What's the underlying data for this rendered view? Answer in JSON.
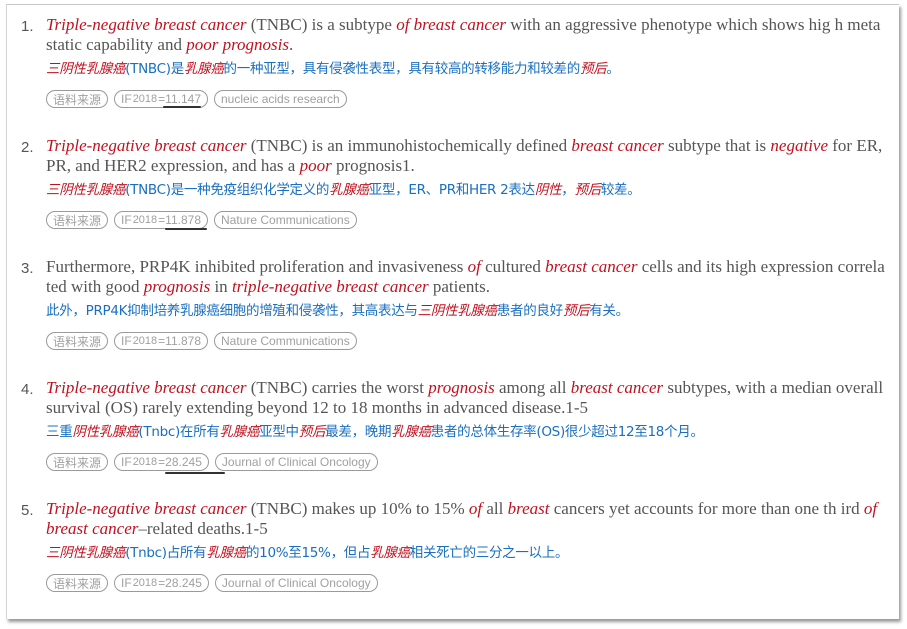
{
  "items": [
    {
      "number": "1.",
      "en_parts": [
        {
          "t": "Triple-negative breast cancer",
          "hl": true
        },
        {
          "t": " (TNBC) is a subtype ",
          "hl": false
        },
        {
          "t": "of breast cancer",
          "hl": true
        },
        {
          "t": " with an aggressive phenotype which shows hig h metastatic capability and ",
          "hl": false
        },
        {
          "t": "poor prognosis",
          "hl": true
        },
        {
          "t": ".",
          "hl": false
        }
      ],
      "zh_parts": [
        {
          "t": "三阴性乳腺癌",
          "hl": true
        },
        {
          "t": "(TNBC)是",
          "hl": false
        },
        {
          "t": "乳腺癌",
          "hl": true
        },
        {
          "t": "的一种亚型，具有侵袭性表型，具有较高的转移能力和较差的",
          "hl": false
        },
        {
          "t": "预后",
          "hl": true
        },
        {
          "t": "。",
          "hl": false
        }
      ],
      "tags": {
        "source": "语料来源",
        "if_prefix": "IF",
        "if_year": "2018",
        "if_value": "=11.147",
        "journal": "nucleic acids research"
      },
      "if_underlined": true
    },
    {
      "number": "2.",
      "en_parts": [
        {
          "t": "Triple-negative breast cancer",
          "hl": true
        },
        {
          "t": " (TNBC) is an immunohistochemically defined ",
          "hl": false
        },
        {
          "t": "breast cancer",
          "hl": true
        },
        {
          "t": " subtype that is ",
          "hl": false
        },
        {
          "t": "negative",
          "hl": true
        },
        {
          "t": " for ER, PR, and HER2 expression, and has a ",
          "hl": false
        },
        {
          "t": "poor",
          "hl": true
        },
        {
          "t": " prognosis1.",
          "hl": false
        }
      ],
      "zh_parts": [
        {
          "t": "三阴性乳腺癌",
          "hl": true
        },
        {
          "t": "(TNBC)是一种免疫组织化学定义的",
          "hl": false
        },
        {
          "t": "乳腺癌",
          "hl": true
        },
        {
          "t": "亚型，ER、PR和HER 2表达",
          "hl": false
        },
        {
          "t": "阴性",
          "hl": true
        },
        {
          "t": "，",
          "hl": false
        },
        {
          "t": "预后",
          "hl": true
        },
        {
          "t": "较差。",
          "hl": false
        }
      ],
      "tags": {
        "source": "语料来源",
        "if_prefix": "IF",
        "if_year": "2018",
        "if_value": "=11.878",
        "journal": "Nature Communications"
      },
      "if_underlined": true
    },
    {
      "number": "3.",
      "en_parts": [
        {
          "t": "Furthermore, PRP4K inhibited proliferation and invasiveness ",
          "hl": false
        },
        {
          "t": "of",
          "hl": true
        },
        {
          "t": " cultured ",
          "hl": false
        },
        {
          "t": "breast cancer",
          "hl": true
        },
        {
          "t": " cells and its high expression correlated with good ",
          "hl": false
        },
        {
          "t": "prognosis",
          "hl": true
        },
        {
          "t": " in ",
          "hl": false
        },
        {
          "t": "triple-negative breast cancer",
          "hl": true
        },
        {
          "t": " patients.",
          "hl": false
        }
      ],
      "zh_parts": [
        {
          "t": "此外，PRP4K抑制培养乳腺癌细胞的增殖和侵袭性，其高表达与",
          "hl": false
        },
        {
          "t": "三阴性乳腺癌",
          "hl": true
        },
        {
          "t": "患者的良好",
          "hl": false
        },
        {
          "t": "预后",
          "hl": true
        },
        {
          "t": "有关。",
          "hl": false
        }
      ],
      "tags": {
        "source": "语料来源",
        "if_prefix": "IF",
        "if_year": "2018",
        "if_value": "=11.878",
        "journal": "Nature Communications"
      },
      "if_underlined": false
    },
    {
      "number": "4.",
      "en_parts": [
        {
          "t": "Triple-negative breast cancer",
          "hl": true
        },
        {
          "t": " (TNBC) carries the worst ",
          "hl": false
        },
        {
          "t": "prognosis",
          "hl": true
        },
        {
          "t": " among all ",
          "hl": false
        },
        {
          "t": "breast cancer",
          "hl": true
        },
        {
          "t": " subtypes, with a median overall survival (OS) rarely extending beyond 12 to 18 months in advanced disease.1-5",
          "hl": false
        }
      ],
      "zh_parts": [
        {
          "t": "三重",
          "hl": false
        },
        {
          "t": "阴性乳腺癌",
          "hl": true
        },
        {
          "t": "(Tnbc)在所有",
          "hl": false
        },
        {
          "t": "乳腺癌",
          "hl": true
        },
        {
          "t": "亚型中",
          "hl": false
        },
        {
          "t": "预后",
          "hl": true
        },
        {
          "t": "最差，晚期",
          "hl": false
        },
        {
          "t": "乳腺癌",
          "hl": true
        },
        {
          "t": "患者的总体生存率(OS)很少超过12至18个月。",
          "hl": false
        }
      ],
      "tags": {
        "source": "语料来源",
        "if_prefix": "IF",
        "if_year": "2018",
        "if_value": "=28.245",
        "journal": "Journal of Clinical Oncology"
      },
      "if_underlined": true
    },
    {
      "number": "5.",
      "en_parts": [
        {
          "t": "Triple-negative breast cancer",
          "hl": true
        },
        {
          "t": " (TNBC) makes up 10% to 15% ",
          "hl": false
        },
        {
          "t": "of",
          "hl": true
        },
        {
          "t": " all ",
          "hl": false
        },
        {
          "t": "breast",
          "hl": true
        },
        {
          "t": " cancers yet accounts for more than one th ird ",
          "hl": false
        },
        {
          "t": "of breast cancer",
          "hl": true
        },
        {
          "t": "–related deaths.1-5",
          "hl": false
        }
      ],
      "zh_parts": [
        {
          "t": "三阴性乳腺癌",
          "hl": true
        },
        {
          "t": "(Tnbc)占所有",
          "hl": false
        },
        {
          "t": "乳腺癌",
          "hl": true
        },
        {
          "t": "的10%至15%，但占",
          "hl": false
        },
        {
          "t": "乳腺癌",
          "hl": true
        },
        {
          "t": "相关死亡的三分之一以上。",
          "hl": false
        }
      ],
      "tags": {
        "source": "语料来源",
        "if_prefix": "IF",
        "if_year": "2018",
        "if_value": "=28.245",
        "journal": "Journal of Clinical Oncology"
      },
      "if_underlined": false
    }
  ],
  "colors": {
    "highlight": "#c0111f",
    "english_text": "#555555",
    "chinese_text": "#1a6fc0",
    "tag_text": "#a0a0a0"
  }
}
